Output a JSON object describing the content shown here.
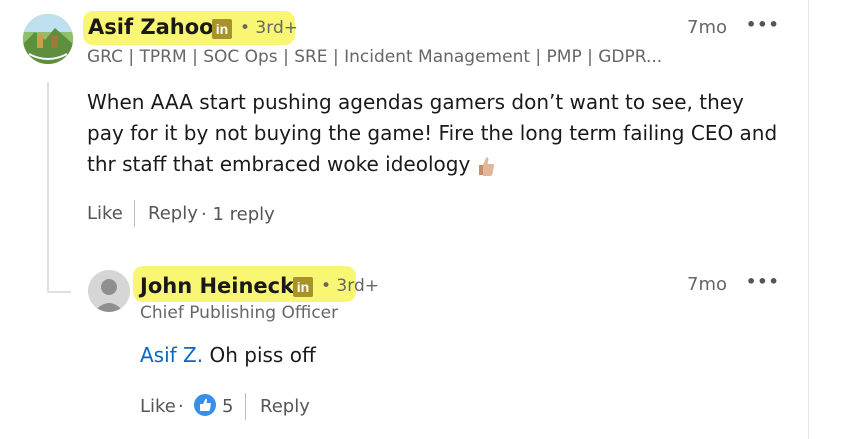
{
  "comment": {
    "author_name": "Asif Zahoor",
    "degree": "• 3rd+",
    "headline": "GRC | TPRM | SOC Ops | SRE | Incident Management | PMP | GDPR...",
    "time": "7mo",
    "more": "•••",
    "text": "When AAA start pushing agendas gamers don’t want to see, they pay for it by not buying the game! Fire the long term failing CEO and thr staff that embraced woke ideology",
    "like_label": "Like",
    "reply_label": "Reply",
    "reply_count": "· 1 reply"
  },
  "reply": {
    "author_name": "John Heinecke",
    "degree": "• 3rd+",
    "headline": "Chief Publishing Officer",
    "time": "7mo",
    "more": "•••",
    "mention": "Asif Z.",
    "text": " Oh piss off",
    "like_label": "Like",
    "dot": "·",
    "reaction_count": "5",
    "reply_label": "Reply"
  },
  "badge_text": "in",
  "colors": {
    "highlight": "#f8f45a",
    "linkedin_badge": "#a8922a",
    "mention": "#0a66c2",
    "reaction": "#378fe9"
  },
  "icons": [
    "avatar-image",
    "linkedin-badge-icon",
    "thumbs-up-emoji-icon",
    "like-reaction-icon",
    "more-options-icon"
  ]
}
